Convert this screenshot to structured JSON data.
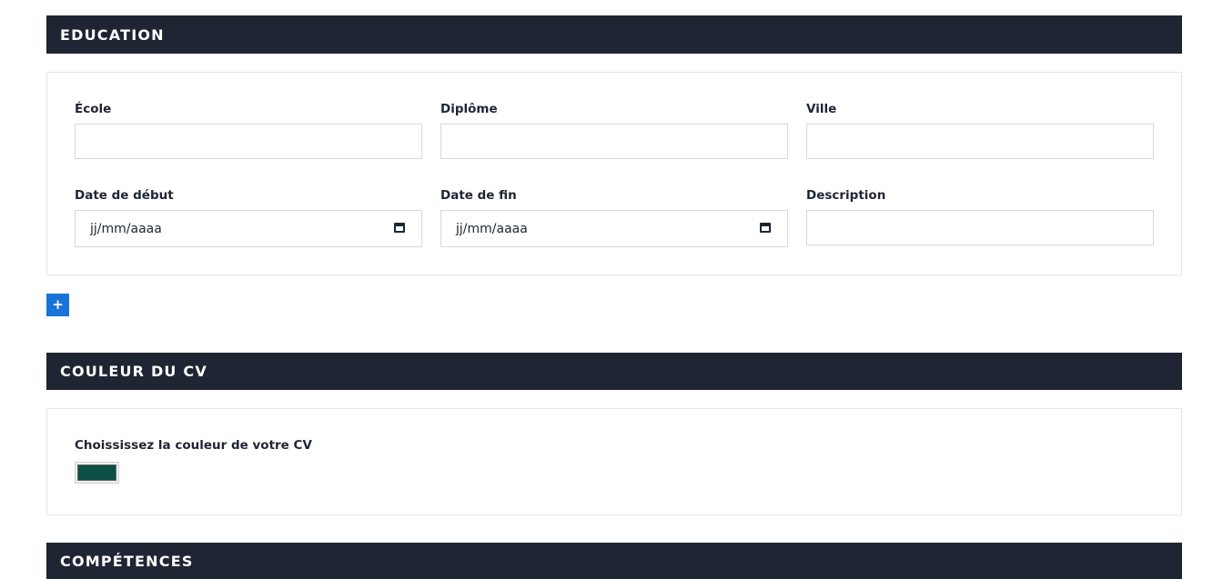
{
  "education": {
    "title": "EDUCATION",
    "fields": {
      "school_label": "École",
      "degree_label": "Diplôme",
      "city_label": "Ville",
      "start_date_label": "Date de début",
      "end_date_label": "Date de fin",
      "description_label": "Description",
      "start_date_value": "jj/mm/aaaa",
      "end_date_value": "jj/mm/aaaa"
    },
    "add_label": "+"
  },
  "cv_color": {
    "title": "COULEUR DU CV",
    "label": "Choississez la couleur de votre CV",
    "selected_color": "#0b4f45"
  },
  "skills": {
    "title": "COMPÉTENCES"
  },
  "colors": {
    "header_bg": "#1f2533",
    "accent": "#1a73d9"
  },
  "icons": {
    "calendar": "calendar-icon"
  }
}
